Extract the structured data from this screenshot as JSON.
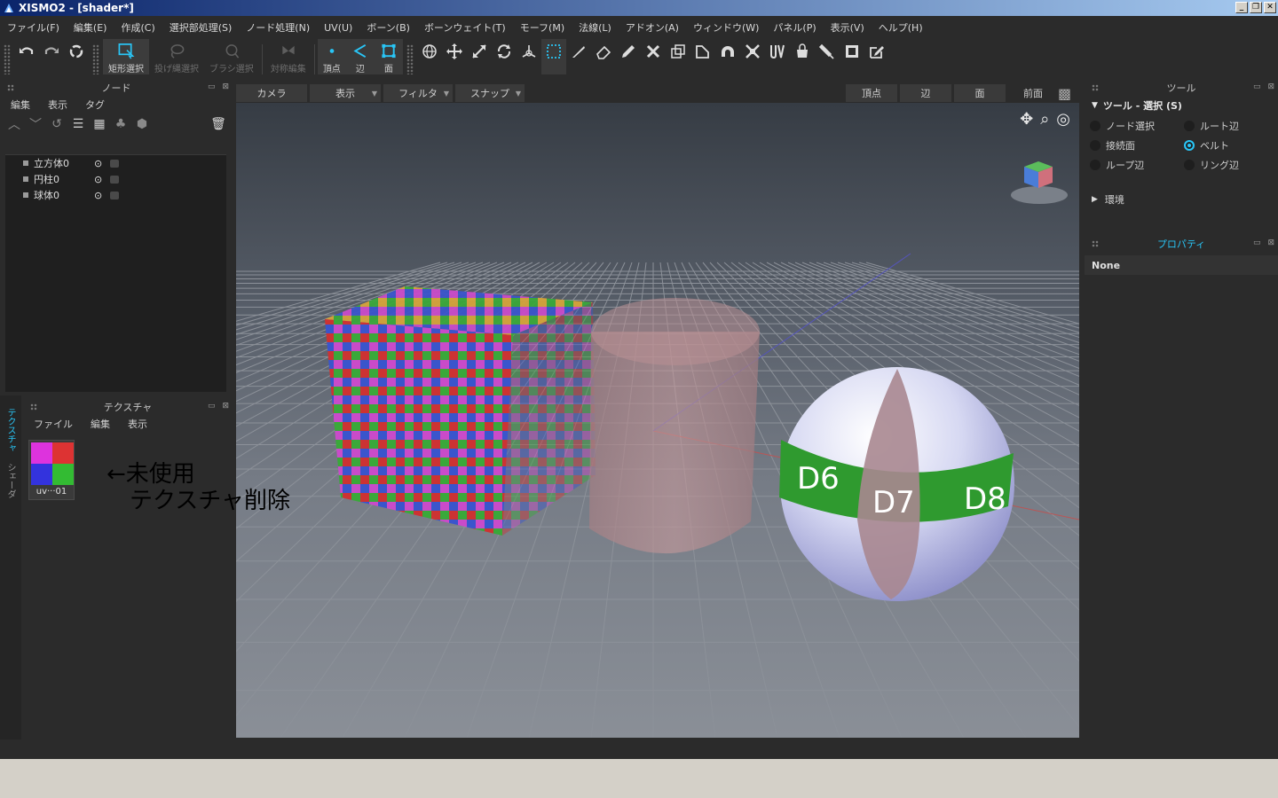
{
  "window": {
    "title": "XISMO2 - [shader*]",
    "buttons": [
      "_",
      "❐",
      "✕"
    ]
  },
  "menu": [
    "ファイル(F)",
    "編集(E)",
    "作成(C)",
    "選択部処理(S)",
    "ノード処理(N)",
    "UV(U)",
    "ボーン(B)",
    "ボーンウェイト(T)",
    "モーフ(M)",
    "法線(L)",
    "アドオン(A)",
    "ウィンドウ(W)",
    "パネル(P)",
    "表示(V)",
    "ヘルプ(H)"
  ],
  "toolbar": {
    "rect_select": "矩形選択",
    "lasso_select": "投げ縄選択",
    "brush_select": "ブラシ選択",
    "sym_edit": "対称編集",
    "vertex": "頂点",
    "edge": "辺",
    "face": "面"
  },
  "node_panel": {
    "title": "ノード",
    "menu": [
      "編集",
      "表示",
      "タグ"
    ],
    "items": [
      {
        "name": "立方体0",
        "eye": "⊙"
      },
      {
        "name": "円柱0",
        "eye": "⊙"
      },
      {
        "name": "球体0",
        "eye": "⊙"
      }
    ]
  },
  "texture_panel": {
    "title": "テクスチャ",
    "menu": [
      "ファイル",
      "編集",
      "表示"
    ],
    "tabs": [
      "テクスチャ",
      "シェーダ"
    ],
    "thumb_caption": "uv···01"
  },
  "annotation": {
    "line1": "←未使用",
    "line2": "テクスチャ削除"
  },
  "viewport": {
    "tabs": [
      {
        "label": "カメラ",
        "dropdown": false
      },
      {
        "label": "表示",
        "dropdown": true
      },
      {
        "label": "フィルタ",
        "dropdown": true
      },
      {
        "label": "スナップ",
        "dropdown": true
      }
    ],
    "right_tabs": [
      "頂点",
      "辺",
      "面"
    ],
    "view_label": "前面",
    "sphere_labels": [
      "D6",
      "D7",
      "D8"
    ]
  },
  "tool_panel": {
    "title": "ツール",
    "section": "ツール - 選択 (S)",
    "options": [
      {
        "label": "ノード選択",
        "on": false
      },
      {
        "label": "ルート辺",
        "on": false
      },
      {
        "label": "接続面",
        "on": false
      },
      {
        "label": "ベルト",
        "on": true
      },
      {
        "label": "ループ辺",
        "on": false
      },
      {
        "label": "リング辺",
        "on": false
      }
    ],
    "env": "環境"
  },
  "props_panel": {
    "title": "プロパティ",
    "value": "None"
  },
  "colors": {
    "accent": "#29c5f6",
    "bg": "#2b2b2b"
  }
}
